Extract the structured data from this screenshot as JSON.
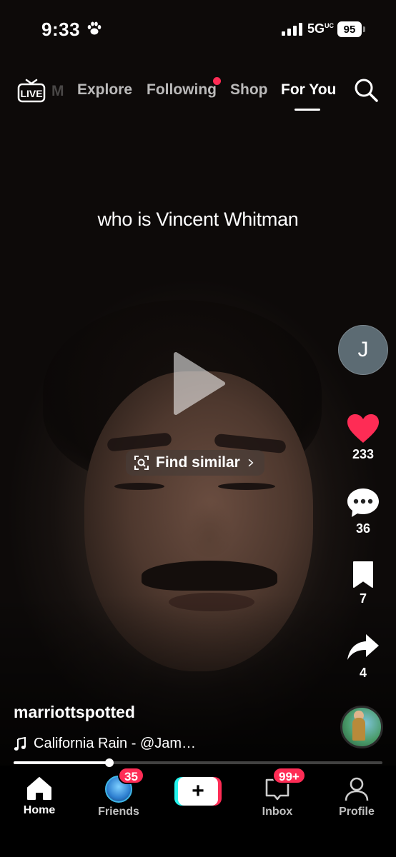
{
  "status_bar": {
    "time": "9:33",
    "network": "5G",
    "network_suffix": "UC",
    "battery": "95"
  },
  "top_nav": {
    "live_label": "LIVE",
    "faded_tab": "M",
    "tabs": [
      "Explore",
      "Following",
      "Shop",
      "For You"
    ],
    "active_tab": "For You"
  },
  "video": {
    "caption": "who is Vincent Whitman",
    "find_similar_label": "Find similar",
    "creator_initial": "J",
    "likes": "233",
    "comments": "36",
    "saves": "7",
    "shares": "4",
    "username": "marriottspotted",
    "sound": "California Rain - @Jam…",
    "progress": 0.26
  },
  "tab_bar": {
    "home": "Home",
    "friends": "Friends",
    "friends_badge": "35",
    "create": "+",
    "inbox": "Inbox",
    "inbox_badge": "99+",
    "profile": "Profile"
  },
  "colors": {
    "accent": "#fe2c55",
    "cyan": "#25f4ee"
  }
}
